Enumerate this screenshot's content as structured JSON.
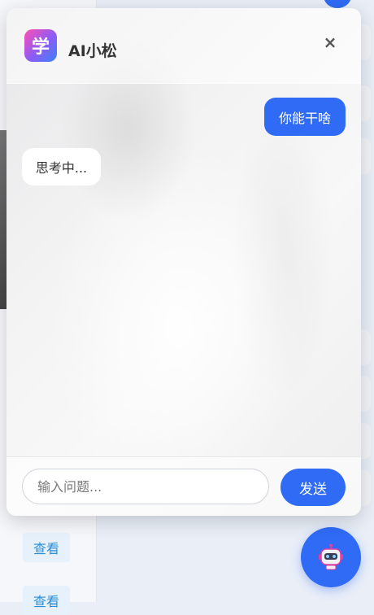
{
  "chat": {
    "title": "AI小松",
    "logo_glyph": "学",
    "close_glyph": "×",
    "messages": [
      {
        "role": "user",
        "text": "你能干啥"
      },
      {
        "role": "assistant",
        "text": "思考中..."
      }
    ],
    "input_placeholder": "输入问题...",
    "send_label": "发送"
  },
  "background": {
    "view_buttons": [
      "查看",
      "查看"
    ]
  },
  "colors": {
    "accent": "#2f6bf5",
    "view_button_text": "#2b8fd8",
    "view_button_bg": "#e6f1fb"
  },
  "icons": {
    "logo": "app-logo-icon",
    "close": "close-icon",
    "fab": "robot-icon"
  }
}
